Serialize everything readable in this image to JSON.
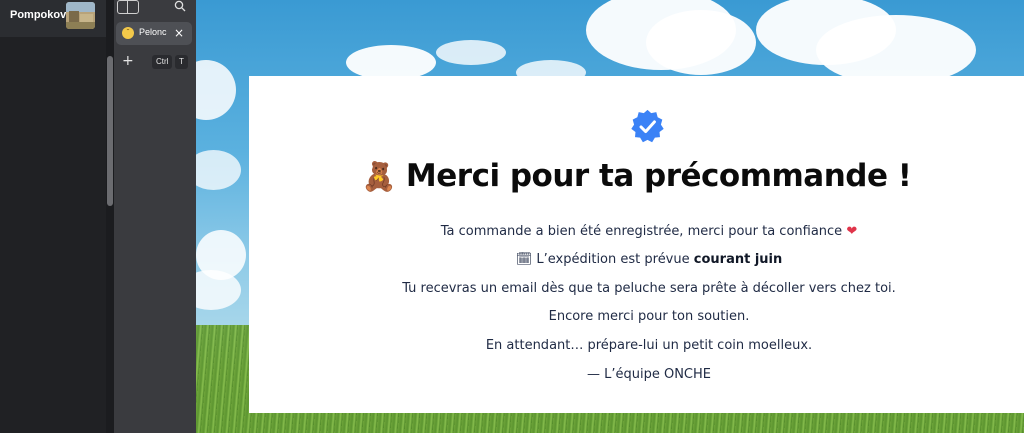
{
  "profile": {
    "name": "Pompokov"
  },
  "tabs": [
    {
      "title": "Pelonci",
      "favicon": "smiley-face-icon",
      "close": "×"
    }
  ],
  "new_tab": {
    "plus": "+",
    "shortcut_keys": [
      "Ctrl",
      "T"
    ]
  },
  "page": {
    "icon": "verified-check-icon",
    "title_emoji": "🧸",
    "title": "Merci pour ta précommande !",
    "line1_text": "Ta commande a bien été enregistrée, merci pour ta confiance",
    "line1_emoji": "❤",
    "line2_emoji": "🗓",
    "line2_text": "L’expédition est prévue",
    "line2_bold": "courant juin",
    "line3": "Tu recevras un email dès que ta peluche sera prête à décoller vers chez toi.",
    "line4": "Encore merci pour ton soutien.",
    "line5": "En attendant… prépare-lui un petit coin moelleux.",
    "signature": "— L’équipe ONCHE"
  },
  "colors": {
    "accent_blue": "#3b82f6",
    "heart": "#e0344a",
    "text_dark": "#1f2a44"
  }
}
